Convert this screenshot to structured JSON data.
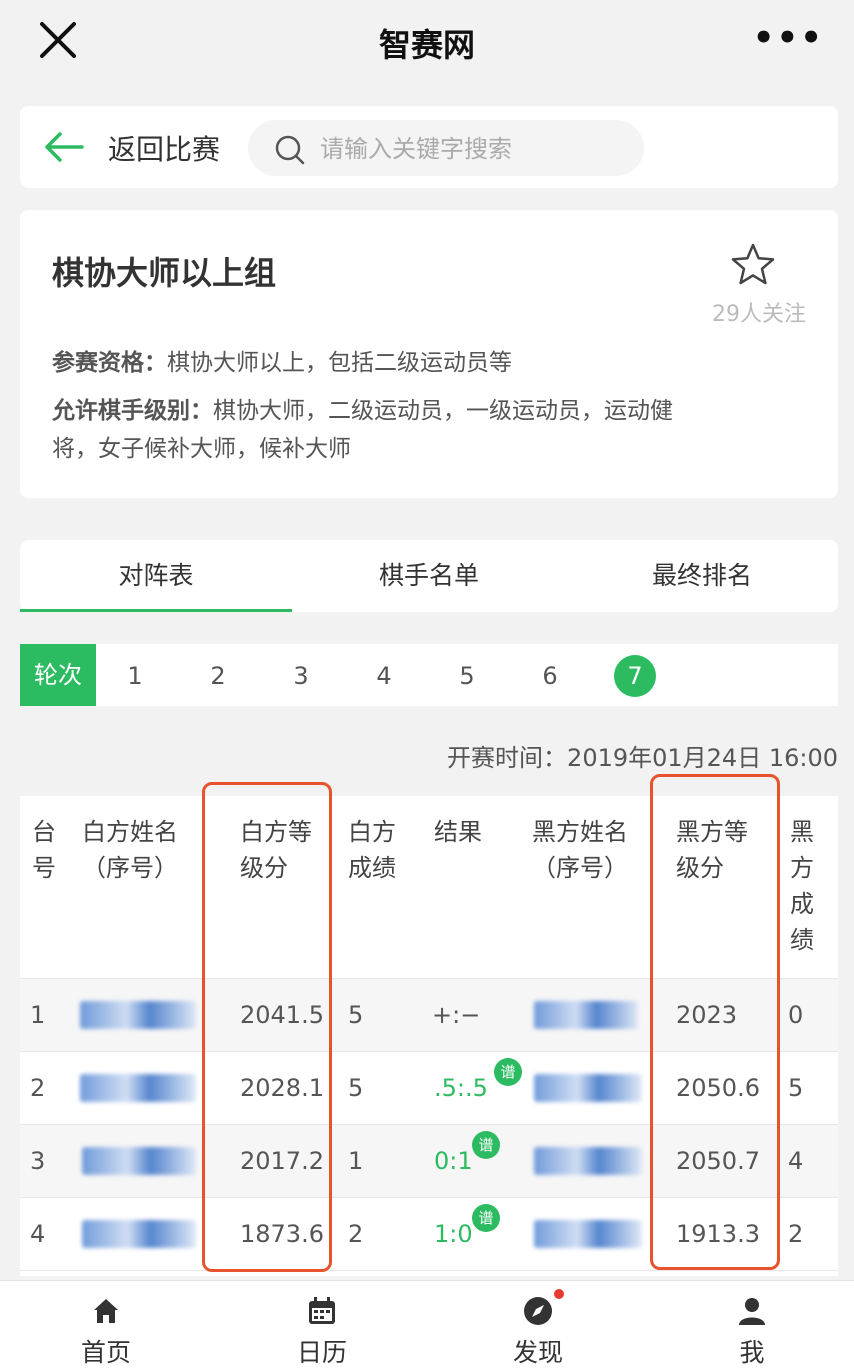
{
  "header": {
    "title": "智赛网"
  },
  "search": {
    "back_label": "返回比赛",
    "placeholder": "请输入关键字搜索"
  },
  "info": {
    "title": "棋协大师以上组",
    "followers": "29人关注",
    "qualification_key": "参赛资格：",
    "qualification_value": "棋协大师以上，包括二级运动员等",
    "levels_key": "允许棋手级别：",
    "levels_value": "棋协大师，二级运动员，一级运动员，运动健",
    "levels_value_2": "将，女子候补大师，候补大师"
  },
  "tabs": [
    {
      "label": "对阵表",
      "active": true
    },
    {
      "label": "棋手名单",
      "active": false
    },
    {
      "label": "最终排名",
      "active": false
    }
  ],
  "rounds": {
    "label": "轮次",
    "items": [
      "1",
      "2",
      "3",
      "4",
      "5",
      "6",
      "7"
    ],
    "active": "7"
  },
  "start_time": "开赛时间：2019年01月24日 16:00",
  "table": {
    "headers": {
      "board": [
        "台",
        "号"
      ],
      "white_name": [
        "白方姓名",
        "（序号）"
      ],
      "white_rating": [
        "白方等",
        "级分"
      ],
      "white_score": [
        "白方",
        "成绩"
      ],
      "result": [
        "结果"
      ],
      "black_name": [
        "黑方姓名",
        "（序号）"
      ],
      "black_rating": [
        "黑方等",
        "级分"
      ],
      "black_score": [
        "黑",
        "方",
        "成",
        "绩"
      ]
    },
    "pu_label": "谱",
    "rows": [
      {
        "board": "1",
        "white_rating": "2041.5",
        "white_score": "5",
        "result": "+:−",
        "black_rating": "2023",
        "black_score": "0"
      },
      {
        "board": "2",
        "white_rating": "2028.1",
        "white_score": "5",
        "result": ".5:.5",
        "black_rating": "2050.6",
        "black_score": "5"
      },
      {
        "board": "3",
        "white_rating": "2017.2",
        "white_score": "1",
        "result": "0:1",
        "black_rating": "2050.7",
        "black_score": "4"
      },
      {
        "board": "4",
        "white_rating": "1873.6",
        "white_score": "2",
        "result": "1:0",
        "black_rating": "1913.3",
        "black_score": "2"
      }
    ]
  },
  "nav": [
    {
      "label": "首页",
      "icon": "home-icon"
    },
    {
      "label": "日历",
      "icon": "calendar-icon"
    },
    {
      "label": "发现",
      "icon": "compass-icon"
    },
    {
      "label": "我",
      "icon": "user-icon"
    }
  ],
  "colors": {
    "accent": "#2dbb62",
    "highlight": "#e8532e",
    "badge": "#e83a2e"
  }
}
